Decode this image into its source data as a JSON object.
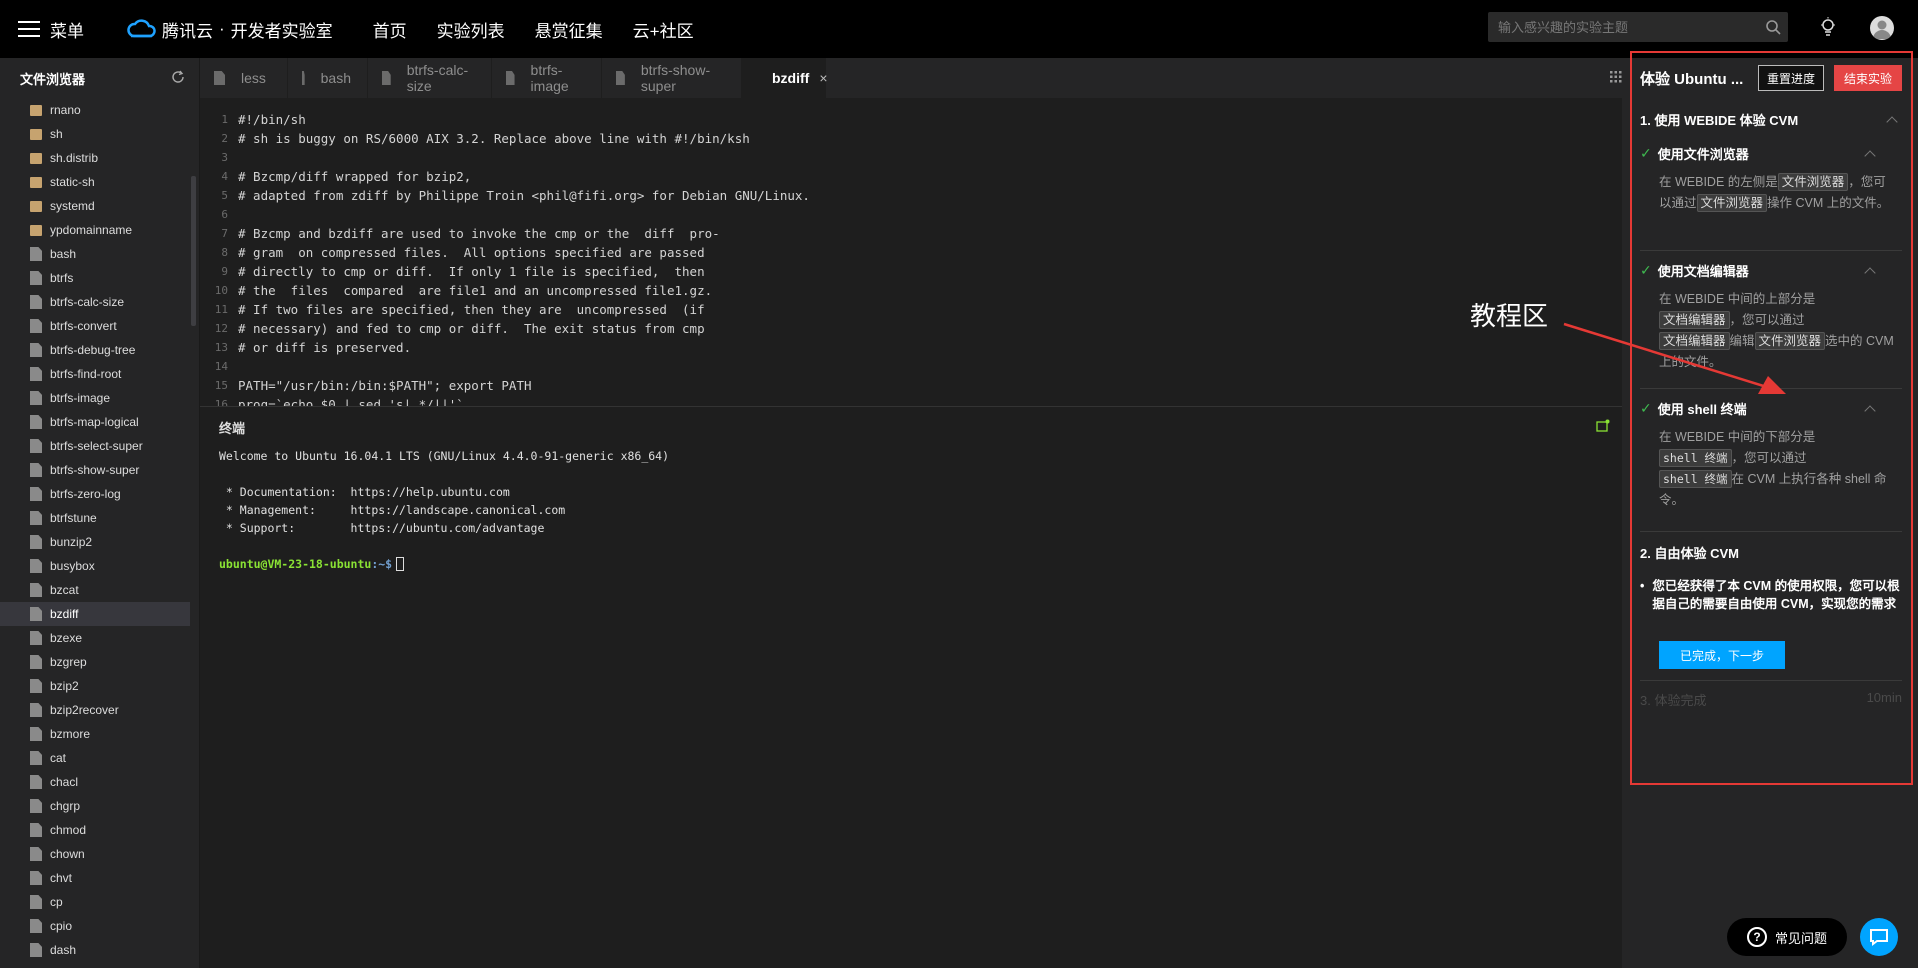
{
  "topbar": {
    "menu_label": "菜单",
    "logo_brand": "腾讯云",
    "logo_dot": "·",
    "logo_product": "开发者实验室",
    "nav": [
      "首页",
      "实验列表",
      "悬赏征集",
      "云+社区"
    ],
    "search_placeholder": "输入感兴趣的实验主题"
  },
  "sidebar": {
    "title": "文件浏览器",
    "files": [
      {
        "name": "rnano",
        "type": "folder"
      },
      {
        "name": "sh",
        "type": "folder"
      },
      {
        "name": "sh.distrib",
        "type": "folder"
      },
      {
        "name": "static-sh",
        "type": "folder"
      },
      {
        "name": "systemd",
        "type": "folder"
      },
      {
        "name": "ypdomainname",
        "type": "folder"
      },
      {
        "name": "bash",
        "type": "file"
      },
      {
        "name": "btrfs",
        "type": "file"
      },
      {
        "name": "btrfs-calc-size",
        "type": "file"
      },
      {
        "name": "btrfs-convert",
        "type": "file"
      },
      {
        "name": "btrfs-debug-tree",
        "type": "file"
      },
      {
        "name": "btrfs-find-root",
        "type": "file"
      },
      {
        "name": "btrfs-image",
        "type": "file"
      },
      {
        "name": "btrfs-map-logical",
        "type": "file"
      },
      {
        "name": "btrfs-select-super",
        "type": "file"
      },
      {
        "name": "btrfs-show-super",
        "type": "file"
      },
      {
        "name": "btrfs-zero-log",
        "type": "file"
      },
      {
        "name": "btrfstune",
        "type": "file"
      },
      {
        "name": "bunzip2",
        "type": "file"
      },
      {
        "name": "busybox",
        "type": "file"
      },
      {
        "name": "bzcat",
        "type": "file"
      },
      {
        "name": "bzdiff",
        "type": "file",
        "active": true
      },
      {
        "name": "bzexe",
        "type": "file"
      },
      {
        "name": "bzgrep",
        "type": "file"
      },
      {
        "name": "bzip2",
        "type": "file"
      },
      {
        "name": "bzip2recover",
        "type": "file"
      },
      {
        "name": "bzmore",
        "type": "file"
      },
      {
        "name": "cat",
        "type": "file"
      },
      {
        "name": "chacl",
        "type": "file"
      },
      {
        "name": "chgrp",
        "type": "file"
      },
      {
        "name": "chmod",
        "type": "file"
      },
      {
        "name": "chown",
        "type": "file"
      },
      {
        "name": "chvt",
        "type": "file"
      },
      {
        "name": "cp",
        "type": "file"
      },
      {
        "name": "cpio",
        "type": "file"
      },
      {
        "name": "dash",
        "type": "file"
      }
    ]
  },
  "tabs": [
    {
      "label": "less"
    },
    {
      "label": "bash"
    },
    {
      "label": "btrfs-calc-size"
    },
    {
      "label": "btrfs-image"
    },
    {
      "label": "btrfs-show-super"
    },
    {
      "label": "bzdiff",
      "active": true,
      "close": "×"
    }
  ],
  "editor": {
    "lines": [
      "#!/bin/sh",
      "# sh is buggy on RS/6000 AIX 3.2. Replace above line with #!/bin/ksh",
      "",
      "# Bzcmp/diff wrapped for bzip2,",
      "# adapted from zdiff by Philippe Troin <phil@fifi.org> for Debian GNU/Linux.",
      "",
      "# Bzcmp and bzdiff are used to invoke the cmp or the  diff  pro-",
      "# gram  on compressed files.  All options specified are passed",
      "# directly to cmp or diff.  If only 1 file is specified,  then",
      "# the  files  compared  are file1 and an uncompressed file1.gz.",
      "# If two files are specified, then they are  uncompressed  (if",
      "# necessary) and fed to cmp or diff.  The exit status from cmp",
      "# or diff is preserved.",
      "",
      "PATH=\"/usr/bin:/bin:$PATH\"; export PATH",
      "prog=`echo $0 | sed 's|.*/||'`"
    ]
  },
  "terminal": {
    "title": "终端",
    "lines": [
      "Welcome to Ubuntu 16.04.1 LTS (GNU/Linux 4.4.0-91-generic x86_64)",
      "",
      " * Documentation:  https://help.ubuntu.com",
      " * Management:     https://landscape.canonical.com",
      " * Support:        https://ubuntu.com/advantage",
      ""
    ],
    "prompt_user": "ubuntu@VM-23-18-ubuntu",
    "prompt_path": ":~$"
  },
  "tutorial": {
    "title": "体验 Ubuntu ...",
    "reset_label": "重置进度",
    "end_label": "结束实验",
    "section1": "1. 使用 WEBIDE 体验 CVM",
    "step1": {
      "title": "使用文件浏览器",
      "t1": "在 WEBIDE 的左侧是",
      "tag1": "文件浏览器",
      "t2": "，您可以通过",
      "tag2": "文件浏览器",
      "t3": "操作 CVM 上的文件。"
    },
    "step2": {
      "title": "使用文档编辑器",
      "t1": "在 WEBIDE 中间的上部分是",
      "tag1": "文档编辑器",
      "t2": "，您可以通过",
      "tag2": "文档编辑器",
      "t3": "编辑",
      "tag3": "文件浏览器",
      "t4": "选中的 CVM 上的文件。"
    },
    "step3": {
      "title": "使用 shell 终端",
      "t1": "在 WEBIDE 中间的下部分是",
      "tag1": "shell 终端",
      "t2": "，您可以通过",
      "tag2": "shell 终端",
      "t3": "在 CVM 上执行各种 shell 命令。"
    },
    "section2": "2. 自由体验 CVM",
    "bullet_mark": "•",
    "bullet": "您已经获得了本 CVM 的使用权限，您可以根据自己的需要自由使用 CVM，实现您的需求",
    "next_label": "已完成，下一步",
    "section3": "3. 体验完成",
    "section3_time": "10min"
  },
  "annotation": {
    "label": "教程区",
    "color": "#e53935"
  },
  "help": {
    "faq_label": "常见问题",
    "faq_icon": "?"
  },
  "colors": {
    "accent": "#00a4ff",
    "danger": "#e54545",
    "check": "#3fb950"
  }
}
